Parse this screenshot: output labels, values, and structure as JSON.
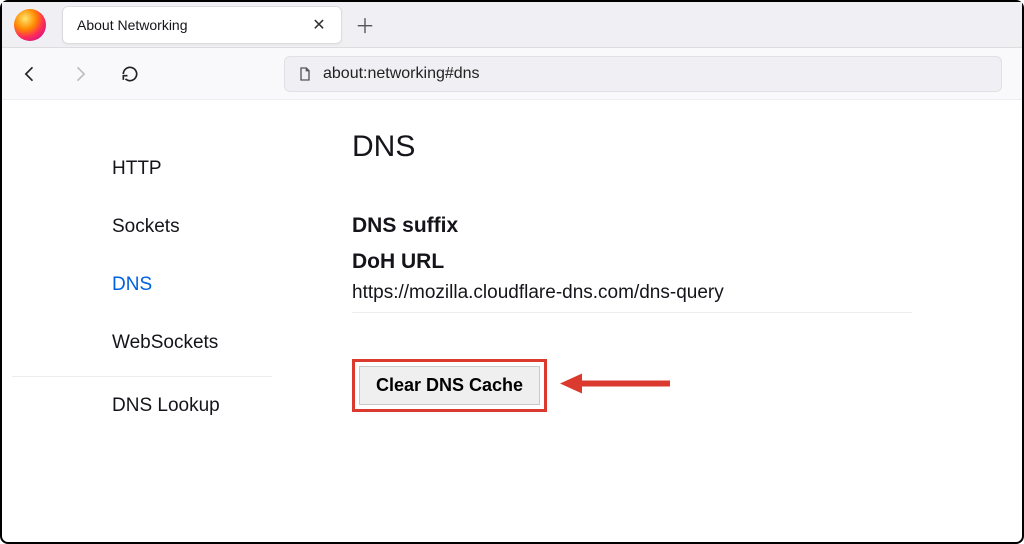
{
  "browser": {
    "tab_title": "About Networking",
    "url": "about:networking#dns"
  },
  "sidebar": {
    "items": [
      {
        "label": "HTTP",
        "active": false
      },
      {
        "label": "Sockets",
        "active": false
      },
      {
        "label": "DNS",
        "active": true
      },
      {
        "label": "WebSockets",
        "active": false
      },
      {
        "label": "DNS Lookup",
        "active": false
      }
    ]
  },
  "main": {
    "title": "DNS",
    "dns_suffix_label": "DNS suffix",
    "dns_suffix_value": "",
    "doh_label": "DoH URL",
    "doh_value": "https://mozilla.cloudflare-dns.com/dns-query",
    "clear_button": "Clear DNS Cache"
  }
}
